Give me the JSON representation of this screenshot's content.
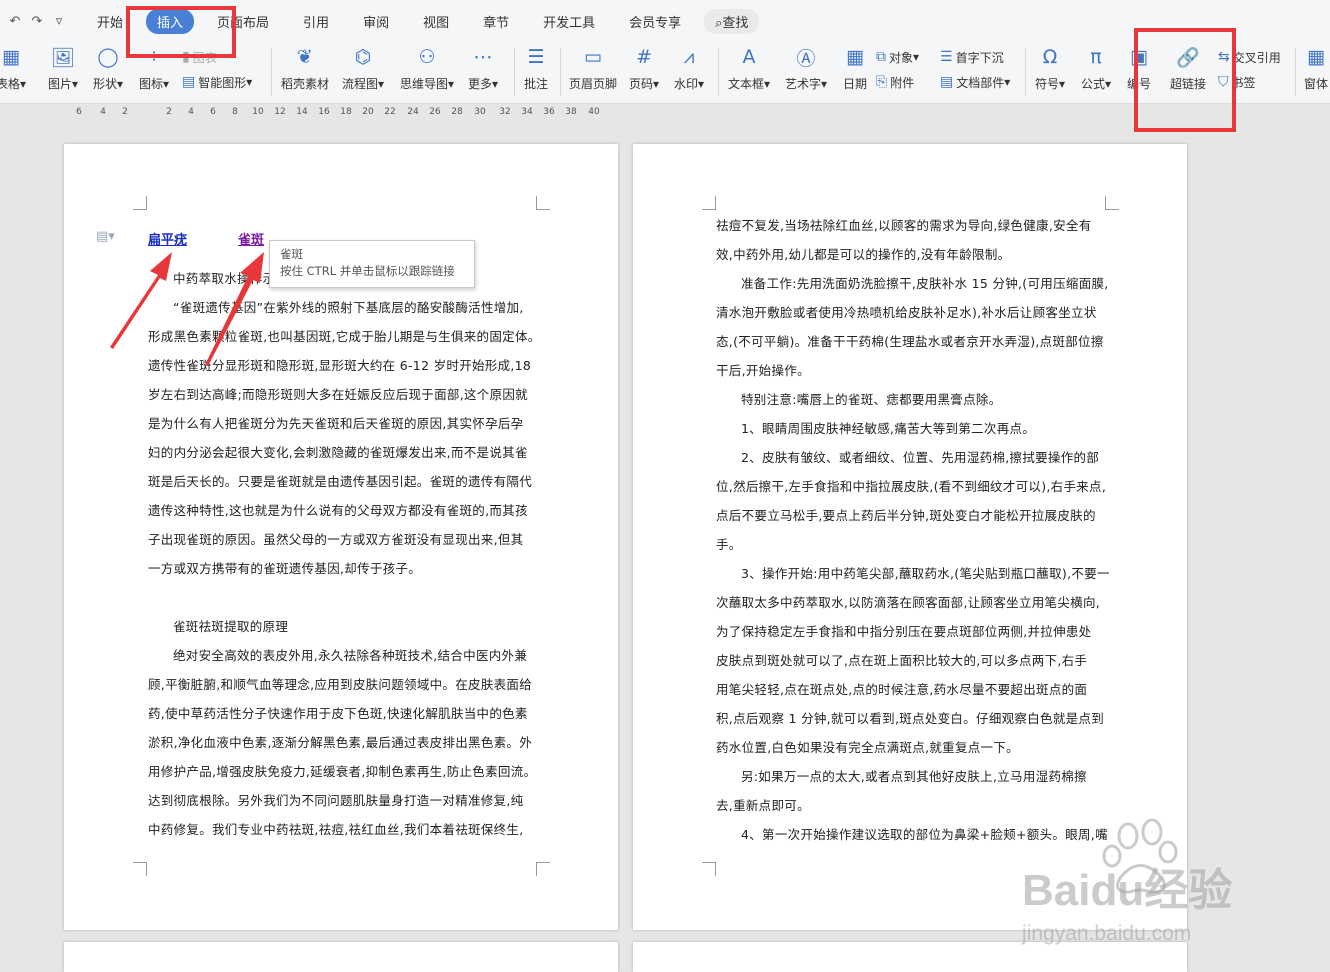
{
  "quick_access": [
    "↶",
    "↷",
    "▿"
  ],
  "tabs": [
    "开始",
    "插入",
    "页面布局",
    "引用",
    "审阅",
    "视图",
    "章节",
    "开发工具",
    "会员专享",
    "查找"
  ],
  "ribbon": {
    "table": "表格",
    "picture": "图片",
    "shape": "形状",
    "icon": "图标",
    "chart": "图表",
    "smart_graphic": "智能图形",
    "stock": "稻壳素材",
    "flow": "流程图",
    "mind": "思维导图",
    "more": "更多",
    "comment": "批注",
    "header_footer": "页眉页脚",
    "page_num": "页码",
    "watermark": "水印",
    "textbox": "文本框",
    "art": "艺术字",
    "date": "日期",
    "object": "对象",
    "attachment": "附件",
    "dropcap": "首字下沉",
    "doc_part": "文档部件",
    "symbol": "符号",
    "formula": "公式",
    "number": "编号",
    "hyperlink": "超链接",
    "cross_ref": "交叉引用",
    "bookmark": "书签",
    "window": "窗体"
  },
  "ruler": [
    "6",
    "4",
    "2",
    "2",
    "4",
    "6",
    "8",
    "10",
    "12",
    "14",
    "16",
    "18",
    "20",
    "22",
    "24",
    "26",
    "28",
    "30",
    "32",
    "34",
    "36",
    "38",
    "40"
  ],
  "links": [
    "扁平疣",
    "雀斑"
  ],
  "tooltip": {
    "title": "雀斑",
    "hint": "按住 CTRL 并单击鼠标以跟踪链接"
  },
  "page1": [
    "中药萃取水操作示",
    "“雀斑遗传基因”在紫外线的照射下基底层的酪安酸酶活性增加,",
    "形成黑色素颗粒雀斑,也叫基因斑,它成于胎儿期是与生俱来的固定体。",
    "遗传性雀斑分显形斑和隐形斑,显形斑大约在 6-12 岁时开始形成,18",
    "岁左右到达高峰;而隐形斑则大多在妊娠反应后现于面部,这个原因就",
    "是为什么有人把雀斑分为先天雀斑和后天雀斑的原因,其实怀孕后孕",
    "妇的内分泌会起很大变化,会刺激隐藏的雀斑爆发出来,而不是说其雀",
    "斑是后天长的。只要是雀斑就是由遗传基因引起。雀斑的遗传有隔代",
    "遗传这种特性,这也就是为什么说有的父母双方都没有雀斑的,而其孩",
    "子出现雀斑的原因。虽然父母的一方或双方雀斑没有显现出来,但其",
    "一方或双方携带有的雀斑遗传基因,却传于孩子。",
    "",
    "雀斑祛斑提取的原理",
    "绝对安全高效的表皮外用,永久祛除各种斑技术,结合中医内外兼",
    "顾,平衡脏腑,和顺气血等理念,应用到皮肤问题领域中。在皮肤表面给",
    "药,使中草药活性分子快速作用于皮下色斑,快速化解肌肤当中的色素",
    "淤积,净化血液中色素,逐渐分解黑色素,最后通过表皮排出黑色素。外",
    "用修护产品,增强皮肤免疫力,延缓衰者,抑制色素再生,防止色素回流。",
    "达到彻底根除。另外我们为不同问题肌肤量身打造一对精准修复,纯",
    "中药修复。我们专业中药祛斑,祛痘,祛红血丝,我们本着祛斑保终生,"
  ],
  "page1_indent": [
    1,
    1,
    0,
    0,
    0,
    0,
    0,
    0,
    0,
    0,
    0,
    0,
    1,
    1,
    0,
    0,
    0,
    0,
    0,
    0
  ],
  "page2": [
    "祛痘不复发,当场祛除红血丝,以顾客的需求为导向,绿色健康,安全有",
    "效,中药外用,幼儿都是可以的操作的,没有年龄限制。",
    "准备工作:先用洗面奶洗脸擦干,皮肤补水 15 分钟,(可用压缩面膜,",
    "清水泡开敷脸或者使用冷热喷机给皮肤补足水),补水后让顾客坐立状",
    "态,(不可平躺)。准备干干药棉(生理盐水或者京开水弄湿),点斑部位擦",
    "干后,开始操作。",
    "特别注意:嘴唇上的雀斑、痣都要用黑膏点除。",
    "1、眼睛周围皮肤神经敏感,痛苦大等到第二次再点。",
    "2、皮肤有皱纹、或者细纹、位置、先用湿药棉,擦拭要操作的部",
    "位,然后擦干,左手食指和中指拉展皮肤,(看不到细纹才可以),右手来点,",
    "点后不要立马松手,要点上药后半分钟,斑处变白才能松开拉展皮肤的",
    "手。",
    "3、操作开始:用中药笔尖部,蘸取药水,(笔尖贴到瓶口蘸取),不要一",
    "次蘸取太多中药萃取水,以防滴落在顾客面部,让顾客坐立用笔尖横向,",
    "为了保持稳定左手食指和中指分别压在要点斑部位两侧,并拉伸患处",
    "皮肤点到斑处就可以了,点在斑上面积比较大的,可以多点两下,右手",
    "用笔尖轻轻,点在斑点处,点的时候注意,药水尽量不要超出斑点的面",
    "积,点后观察 1 分钟,就可以看到,斑点处变白。仔细观察白色就是点到",
    "药水位置,白色如果没有完全点满斑点,就重复点一下。",
    "另:如果万一点的太大,或者点到其他好皮肤上,立马用湿药棉擦",
    "去,重新点即可。",
    "4、第一次开始操作建议选取的部位为鼻梁+脸颊+额头。眼周,嘴"
  ],
  "page2_indent": [
    0,
    0,
    1,
    0,
    0,
    0,
    1,
    1,
    1,
    0,
    0,
    0,
    1,
    0,
    0,
    0,
    0,
    0,
    0,
    1,
    0,
    1
  ],
  "watermark": {
    "brand": "Baidu经验",
    "url": "jingyan.baidu.com"
  },
  "colors": {
    "link_visited": "#7b1fa2",
    "link": "#1a2fc7",
    "highlight": "#e8373b",
    "tab_active": "#4a7fd6"
  }
}
